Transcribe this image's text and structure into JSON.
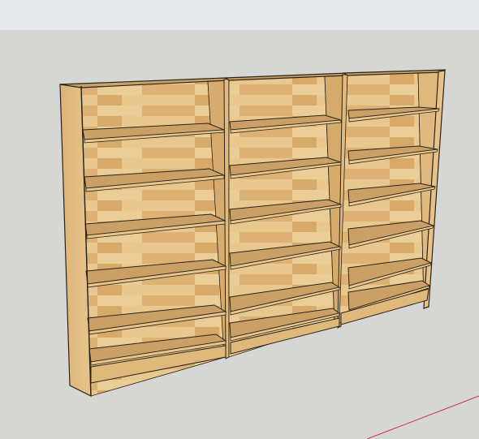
{
  "app": {
    "window_title": "",
    "viewport_background": "#d6d6d4",
    "toolbar_background": "#e7e9ec"
  },
  "scene": {
    "model_name": "",
    "units": [
      {
        "id": "left-bookcase",
        "shelves": 6
      },
      {
        "id": "middle-bookcase",
        "shelves": 6
      },
      {
        "id": "right-bookcase",
        "shelves": 6
      }
    ],
    "wood_colors": {
      "light": "#e8c48a",
      "mid": "#ddb06f",
      "dark": "#c89b5b",
      "edge": "#2a2418"
    },
    "red_axis_color": "#c8323c"
  }
}
